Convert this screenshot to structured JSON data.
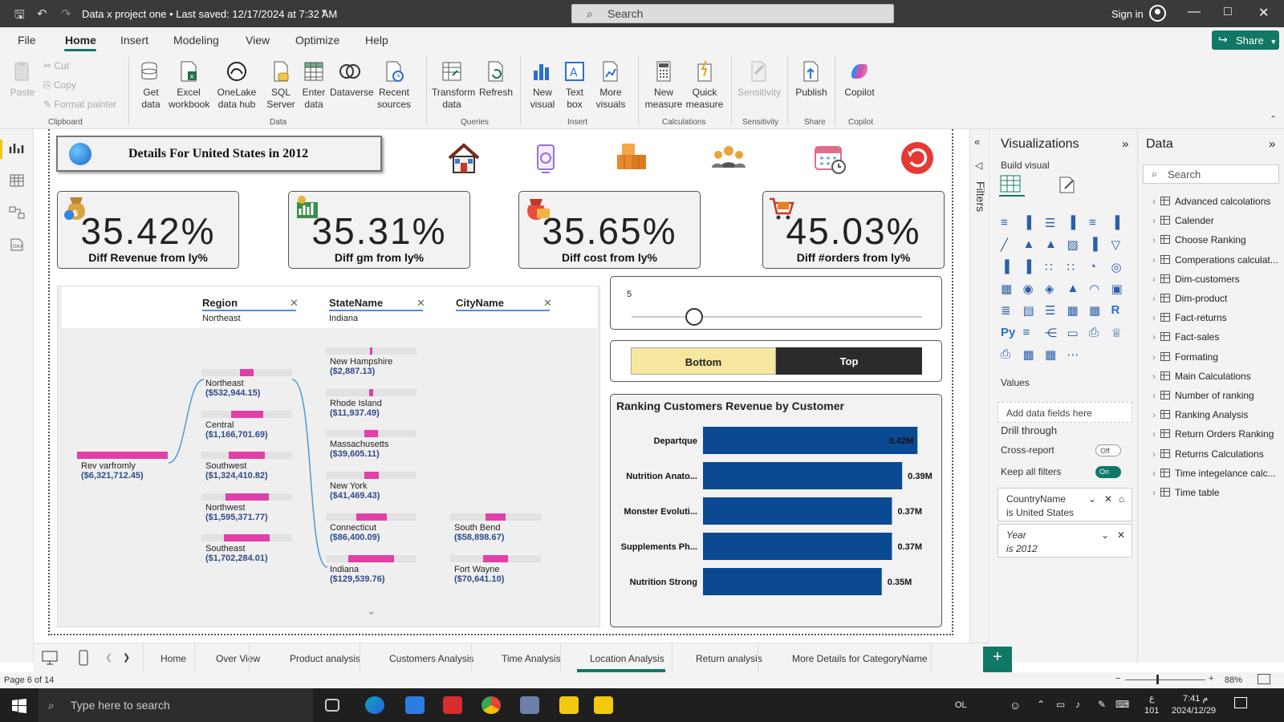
{
  "titlebar": {
    "doc_title": "Data x project one • Last saved: 12/17/2024 at 7:32 AM",
    "search_placeholder": "Search",
    "signin": "Sign in"
  },
  "menu": {
    "items": [
      "File",
      "Home",
      "Insert",
      "Modeling",
      "View",
      "Optimize",
      "Help"
    ],
    "share": "Share"
  },
  "ribbon": {
    "clipboard": {
      "paste": "Paste",
      "cut": "Cut",
      "copy": "Copy",
      "format_painter": "Format painter",
      "group": "Clipboard"
    },
    "data": {
      "get_data": "Get data",
      "excel": "Excel workbook",
      "onelake": "OneLake data hub",
      "sql": "SQL Server",
      "enter": "Enter data",
      "dataverse": "Dataverse",
      "recent": "Recent sources",
      "group": "Data"
    },
    "queries": {
      "transform": "Transform data",
      "refresh": "Refresh",
      "group": "Queries"
    },
    "insert": {
      "new_visual": "New visual",
      "text_box": "Text box",
      "more_visuals": "More visuals",
      "group": "Insert"
    },
    "calculations": {
      "new_measure": "New measure",
      "quick_measure": "Quick measure",
      "group": "Calculations"
    },
    "sensitivity": {
      "label": "Sensitivity",
      "group": "Sensitivity"
    },
    "share": {
      "publish": "Publish",
      "group": "Share"
    },
    "copilot": {
      "label": "Copilot",
      "group": "Copilot"
    }
  },
  "report": {
    "header_title": "Details For United States in 2012",
    "kpis": [
      {
        "value": "35.42%",
        "label": "Diff Revenue from ly%"
      },
      {
        "value": "35.31%",
        "label": "Diff gm from ly%"
      },
      {
        "value": "35.65%",
        "label": "Diff cost from ly%"
      },
      {
        "value": "45.03%",
        "label": "Diff #orders from ly%"
      }
    ],
    "slicers": [
      {
        "header": "Region",
        "value": "Northeast"
      },
      {
        "header": "StateName",
        "value": "Indiana"
      },
      {
        "header": "CityName",
        "value": ""
      }
    ],
    "decomp": {
      "root": {
        "name": "Rev varfromly",
        "value": "($6,321,712.45)"
      },
      "regions": [
        {
          "name": "Northeast",
          "value": "($532,944.15)",
          "fill": 0.3
        },
        {
          "name": "Central",
          "value": "($1,166,701.69)",
          "fill": 0.7
        },
        {
          "name": "Southwest",
          "value": "($1,324,410.82)",
          "fill": 0.8
        },
        {
          "name": "Northwest",
          "value": "($1,595,371.77)",
          "fill": 0.95
        },
        {
          "name": "Southeast",
          "value": "($1,702,284.01)",
          "fill": 1.0
        }
      ],
      "states": [
        {
          "name": "New Hampshire",
          "value": "($2,887.13)",
          "fill": 0.02
        },
        {
          "name": "Rhode Island",
          "value": "($11,937.49)",
          "fill": 0.09
        },
        {
          "name": "Massachusetts",
          "value": "($39,605.11)",
          "fill": 0.3
        },
        {
          "name": "New York",
          "value": "($41,469.43)",
          "fill": 0.32
        },
        {
          "name": "Connecticut",
          "value": "($86,400.09)",
          "fill": 0.67
        },
        {
          "name": "Indiana",
          "value": "($129,539.76)",
          "fill": 1.0
        }
      ],
      "cities": [
        {
          "name": "South Bend",
          "value": "($58,898.67)",
          "fill": 0.45
        },
        {
          "name": "Fort Wayne",
          "value": "($70,641.10)",
          "fill": 0.55
        }
      ]
    },
    "slider_value": "5",
    "toggle": {
      "bottom": "Bottom",
      "top": "Top"
    }
  },
  "chart_data": {
    "type": "bar",
    "title": "Ranking Customers Revenue by Customer",
    "categories": [
      "Departque",
      "Nutrition Anato...",
      "Monster Evoluti...",
      "Supplements Ph...",
      "Nutrition Strong"
    ],
    "values": [
      0.42,
      0.39,
      0.37,
      0.37,
      0.35
    ],
    "data_labels": [
      "0.42M",
      "0.39M",
      "0.37M",
      "0.37M",
      "0.35M"
    ],
    "color": "#0b4a93",
    "xlim": [
      0,
      0.44
    ]
  },
  "filters_label": "Filters",
  "visualizations": {
    "title": "Visualizations",
    "build_visual": "Build visual",
    "values": "Values",
    "add_fields": "Add data fields here",
    "drill_through": "Drill through",
    "cross_report": "Cross-report",
    "cross_report_state": "Off",
    "keep_filters": "Keep all filters",
    "keep_filters_state": "On",
    "filter_cards": [
      {
        "field": "CountryName",
        "condition": "is United States"
      },
      {
        "field": "Year",
        "condition": "is 2012"
      }
    ]
  },
  "data_pane": {
    "title": "Data",
    "search_placeholder": "Search",
    "tables": [
      "Advanced calcolations",
      "Calender",
      "Choose Ranking",
      "Comperations calculat...",
      "Dim-customers",
      "Dim-product",
      "Fact-returns",
      "Fact-sales",
      "Formating",
      "Main Calculations",
      "Number of ranking",
      "Ranking Analysis",
      "Return Orders Ranking",
      "Returns Calculations",
      "Time integelance calc...",
      "Time table"
    ]
  },
  "page_tabs": [
    "Home",
    "Over View",
    "Product analysis",
    "Customers Analysis",
    "Time Analysis",
    "Location Analysis",
    "Return analysis",
    "More Details for CategoryName"
  ],
  "status": {
    "page": "Page 6 of 14",
    "zoom": "88%"
  },
  "taskbar": {
    "search": "Type here to search",
    "lang": "OL",
    "time": "7:41 م",
    "date": "2024/12/29",
    "num": "101",
    "letter": "ع"
  },
  "colors": {
    "accent": "#117865",
    "pink": "#e23fa8",
    "bar": "#0b4a93",
    "bottom_btn": "#f5e79e",
    "top_btn": "#2b2b2b"
  }
}
